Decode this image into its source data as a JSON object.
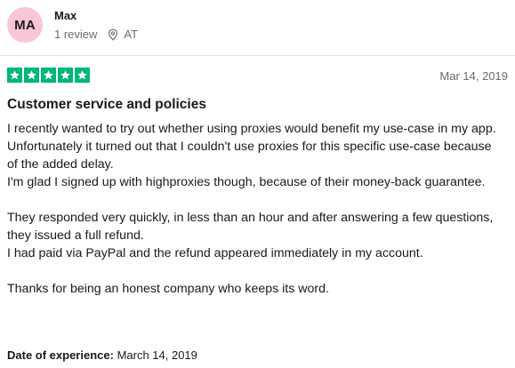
{
  "reviewer": {
    "initials": "MA",
    "name": "Max",
    "reviews": "1 review",
    "country": "AT",
    "avatar_color": "#f8c6d4"
  },
  "review": {
    "rating": 5,
    "star_color": "#00b67a",
    "date": "Mar 14, 2019",
    "title": "Customer service and policies",
    "paragraphs": [
      [
        "I recently wanted to try out whether using proxies would benefit my use-case in my app.",
        "Unfortunately it turned out that I couldn't use proxies for this specific use-case because of the added delay.",
        "I'm glad I signed up with highproxies though, because of their money-back guarantee."
      ],
      [
        "They responded very quickly, in less than an hour and after answering a few questions, they issued a full refund.",
        "I had paid via PayPal and the refund appeared immediately in my account."
      ],
      [
        "Thanks for being an honest company who keeps its word."
      ]
    ],
    "experience_label": "Date of experience:",
    "experience_date": "March 14, 2019"
  },
  "icons": {
    "location": "location-pin-icon",
    "star": "star-icon"
  }
}
